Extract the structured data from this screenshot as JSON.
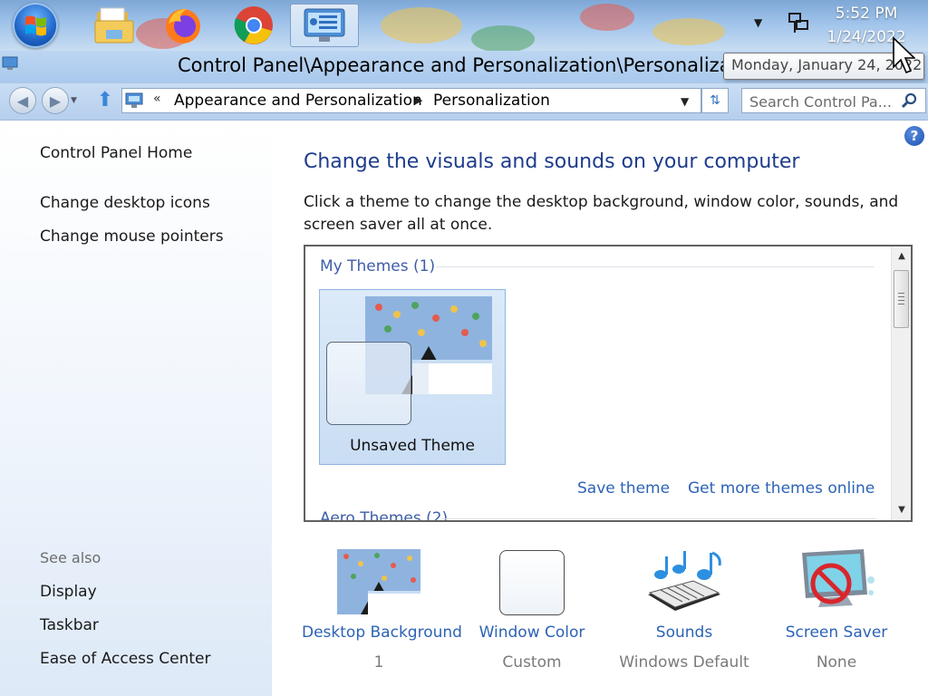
{
  "taskbar": {
    "pinned": [
      "start-orb",
      "file-explorer-icon",
      "firefox-icon",
      "chrome-icon",
      "control-panel-icon"
    ],
    "clock": {
      "time": "5:52 PM",
      "date": "1/24/2022"
    },
    "tooltip": "Monday, January 24, 2022"
  },
  "window": {
    "title": "Control Panel\\Appearance and Personalization\\Personalization"
  },
  "addressbar": {
    "overflow": "«",
    "crumbs": [
      "Appearance and Personalization",
      "Personalization"
    ],
    "search_placeholder": "Search Control Pa..."
  },
  "sidebar": {
    "home": "Control Panel Home",
    "tasks": [
      "Change desktop icons",
      "Change mouse pointers"
    ],
    "see_also_title": "See also",
    "see_also": [
      "Display",
      "Taskbar",
      "Ease of Access Center"
    ]
  },
  "main": {
    "title": "Change the visuals and sounds on your computer",
    "description": "Click a theme to change the desktop background, window color, sounds, and screen saver all at once.",
    "themes": {
      "my_themes_header": "My Themes (1)",
      "selected_theme": "Unsaved Theme",
      "save_link": "Save theme",
      "more_link": "Get more themes online",
      "aero_header": "Aero Themes (2)"
    },
    "settings": [
      {
        "label": "Desktop Background",
        "value": "1",
        "icon": "desktop-background-thumbnail"
      },
      {
        "label": "Window Color",
        "value": "Custom",
        "icon": "window-color-swatch"
      },
      {
        "label": "Sounds",
        "value": "Windows Default",
        "icon": "sounds-icon"
      },
      {
        "label": "Screen Saver",
        "value": "None",
        "icon": "screen-saver-icon"
      }
    ]
  },
  "colors": {
    "link": "#2c63b5",
    "title": "#1e3c8c",
    "header": "#3f5ea8",
    "tile_selected": "#c9ddf3"
  }
}
